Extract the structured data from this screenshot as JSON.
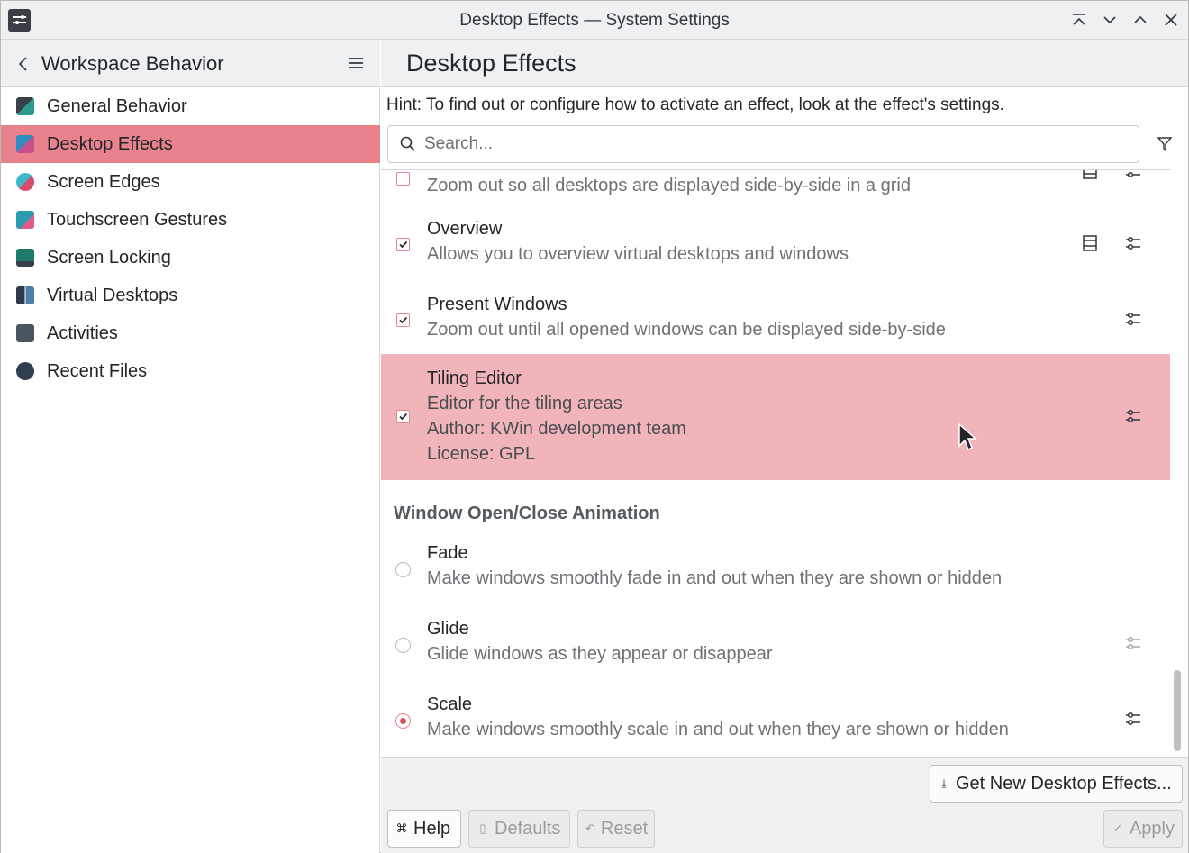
{
  "window": {
    "title": "Desktop Effects — System Settings"
  },
  "sidebar": {
    "title": "Workspace Behavior",
    "items": [
      {
        "label": "General Behavior",
        "icon": "general-behavior-icon",
        "color": "#2d9a8c"
      },
      {
        "label": "Desktop Effects",
        "icon": "desktop-effects-icon",
        "color": "#2f8dbf",
        "active": true
      },
      {
        "label": "Screen Edges",
        "icon": "screen-edges-icon",
        "color": "#d84b6c"
      },
      {
        "label": "Touchscreen Gestures",
        "icon": "touchscreen-gestures-icon",
        "color": "#2b9bb0"
      },
      {
        "label": "Screen Locking",
        "icon": "screen-locking-icon",
        "color": "#1f7a6a"
      },
      {
        "label": "Virtual Desktops",
        "icon": "virtual-desktops-icon",
        "color": "#2b3a4a"
      },
      {
        "label": "Activities",
        "icon": "activities-icon",
        "color": "#4a5560"
      },
      {
        "label": "Recent Files",
        "icon": "recent-files-icon",
        "color": "#2c3e50"
      }
    ]
  },
  "main": {
    "title": "Desktop Effects",
    "hint": "Hint: To find out or configure how to activate an effect, look at the effect's settings.",
    "search_placeholder": "Search...",
    "effects": [
      {
        "name": "",
        "lines": [
          "Zoom out so all desktops are displayed side-by-side in a grid"
        ],
        "control": "checkbox",
        "checked": true,
        "video": true,
        "configure": true
      },
      {
        "name": "Overview",
        "lines": [
          "Allows you to overview virtual desktops and windows"
        ],
        "control": "checkbox",
        "checked": true,
        "video": true,
        "configure": true
      },
      {
        "name": "Present Windows",
        "lines": [
          "Zoom out until all opened windows can be displayed side-by-side"
        ],
        "control": "checkbox",
        "checked": true,
        "video": false,
        "configure": true
      },
      {
        "name": "Tiling Editor",
        "lines": [
          "Editor for the tiling areas",
          "Author: KWin development team",
          "License: GPL"
        ],
        "control": "checkbox",
        "checked": true,
        "video": false,
        "configure": true,
        "selected": true
      }
    ],
    "section": "Window Open/Close Animation",
    "animations": [
      {
        "name": "Fade",
        "line": "Make windows smoothly fade in and out when they are shown or hidden",
        "checked": false,
        "configure": false
      },
      {
        "name": "Glide",
        "line": "Glide windows as they appear or disappear",
        "checked": false,
        "configure": true,
        "configure_disabled": true
      },
      {
        "name": "Scale",
        "line": "Make windows smoothly scale in and out when they are shown or hidden",
        "checked": true,
        "configure": true
      }
    ]
  },
  "footer": {
    "get_new": "Get New Desktop Effects...",
    "help": "Help",
    "defaults": "Defaults",
    "reset": "Reset",
    "apply": "Apply"
  },
  "colors": {
    "accent": "#e8838d",
    "selected_row": "#f1b4ba"
  }
}
